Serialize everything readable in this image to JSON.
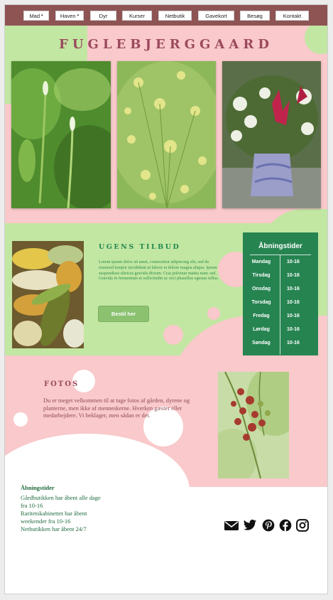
{
  "nav": {
    "items": [
      {
        "label": "Mad",
        "dropdown": true
      },
      {
        "label": "Haven",
        "dropdown": true
      },
      {
        "label": "Dyr"
      },
      {
        "label": "Kurser"
      },
      {
        "label": "Netbutik"
      },
      {
        "label": "Gavekort"
      },
      {
        "label": "Besøg"
      },
      {
        "label": "Kontakt"
      }
    ],
    "caret": "▾"
  },
  "hero": {
    "title": "FUGLEBJERGGAARD",
    "photos": [
      "garlic-flowers-photo",
      "dill-flowers-photo",
      "flower-bouquet-photo"
    ]
  },
  "offer": {
    "title": "UGENS TILBUD",
    "text": "Lorem ipsum dolor sit amet, consectetur adipiscing elit, sed do eiusmod tempor incididunt ut labore et dolore magna aliqua. Ipsum suspendisse ultrices gravida dictum. Cras pulvinar mattis nunc sed. Gravida in fermentum et sollicitudin ac orci phasellus egestas tellus.",
    "button_label": "Bestil her"
  },
  "hours": {
    "title": "Åbningstider",
    "rows": [
      {
        "day": "Mandag",
        "time": "10-16"
      },
      {
        "day": "Tirsdag",
        "time": "10-16"
      },
      {
        "day": "Onsdag",
        "time": "10-16"
      },
      {
        "day": "Torsdag",
        "time": "10-16"
      },
      {
        "day": "Fredag",
        "time": "10-16"
      },
      {
        "day": "Lørdag",
        "time": "10-16"
      },
      {
        "day": "Søndag",
        "time": "10-16"
      }
    ]
  },
  "photos": {
    "title": "FOTOS",
    "text": "Du er meget velkommen til at tage fotos af gården, dyrene og planterne, men ikke af menneskerne. Hverken gæster eller medarbejdere. Vi beklager, men sådan er det."
  },
  "footer": {
    "heading": "Åbningstider",
    "lines": [
      "Gårdbutikken har åbent alle dage",
      "fra 10-16",
      "Raritetskabinettet har åbent",
      "weekender fra 10-16",
      "Netbutikken har åbent 24/7"
    ]
  },
  "social": [
    "mail-icon",
    "twitter-icon",
    "pinterest-icon",
    "facebook-icon",
    "instagram-icon"
  ],
  "colors": {
    "nav": "#8e5454",
    "pink": "#f9c9cb",
    "green_light": "#c2e7a2",
    "green_dark": "#268451",
    "title": "#9b4a5c"
  }
}
